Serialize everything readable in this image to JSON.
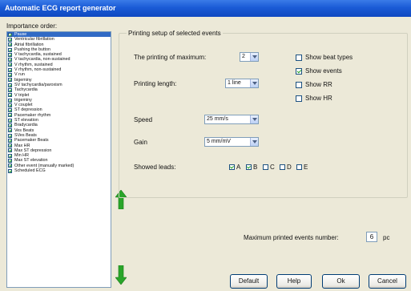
{
  "window": {
    "title": "Automatic ECG report generator"
  },
  "importance": {
    "label": "Importance order:",
    "items": [
      {
        "label": "Pause",
        "selected": true
      },
      {
        "label": "Ventricular fibrillation"
      },
      {
        "label": "Atrial fibrillation"
      },
      {
        "label": "Pushing the button"
      },
      {
        "label": "V tachycardia, sustained"
      },
      {
        "label": "V tachycardia, non-sustained"
      },
      {
        "label": "V rhythm, sustained"
      },
      {
        "label": "V rhythm, non-sustained"
      },
      {
        "label": "V run"
      },
      {
        "label": "bigeminy"
      },
      {
        "label": "SV tachycardia/paroxism"
      },
      {
        "label": "Tachycardia"
      },
      {
        "label": "V triplet"
      },
      {
        "label": "trigeminy"
      },
      {
        "label": "V couplet"
      },
      {
        "label": "ST depression"
      },
      {
        "label": "Pacemaker rhythm"
      },
      {
        "label": "ST elevation"
      },
      {
        "label": "Bradycardia"
      },
      {
        "label": "Ves Beats"
      },
      {
        "label": "SVes Beats"
      },
      {
        "label": "Pacemaker Beats"
      },
      {
        "label": "Max HR"
      },
      {
        "label": "Max ST depression"
      },
      {
        "label": "Min HR"
      },
      {
        "label": "Max ST elevation"
      },
      {
        "label": "Other event (manually marked)"
      },
      {
        "label": "Scheduled ECG"
      }
    ]
  },
  "setup": {
    "group_title": "Printing setup of selected events",
    "printing_of_maximum_label": "The printing of maximum:",
    "printing_of_maximum_value": "2",
    "printing_length_label": "Printing length:",
    "printing_length_value": "1 line",
    "speed_label": "Speed",
    "speed_value": "25 mm/s",
    "gain_label": "Gain",
    "gain_value": "5 mm/mV",
    "showed_leads_label": "Showed leads:",
    "leads": [
      {
        "label": "A",
        "checked": true
      },
      {
        "label": "B",
        "checked": true
      },
      {
        "label": "C",
        "checked": false
      },
      {
        "label": "D",
        "checked": false
      },
      {
        "label": "E",
        "checked": false
      }
    ],
    "options": [
      {
        "label": "Show beat types",
        "checked": false
      },
      {
        "label": "Show events",
        "checked": true
      },
      {
        "label": "Show RR",
        "checked": false
      },
      {
        "label": "Show HR",
        "checked": false
      }
    ]
  },
  "max_events": {
    "label": "Maximum printed events number:",
    "value": "6",
    "unit": "pc"
  },
  "buttons": {
    "default": "Default",
    "help": "Help",
    "ok": "Ok",
    "cancel": "Cancel"
  },
  "colors": {
    "title_bar": "#1a5bd6",
    "selection": "#316ac5",
    "arrow_green": "#2aa52a"
  }
}
